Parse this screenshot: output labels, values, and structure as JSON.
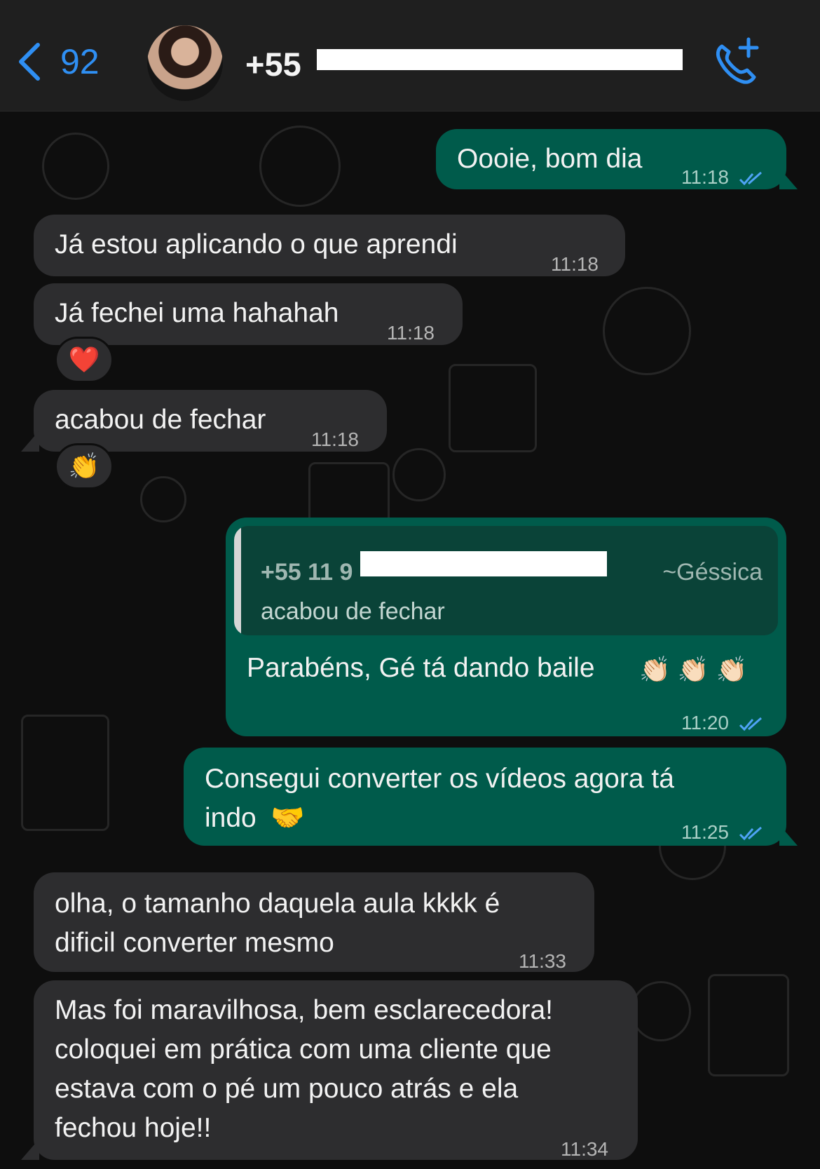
{
  "header": {
    "back_count": "92",
    "contact_phone_visible": "+55",
    "avatar_icon": "contact-avatar",
    "call_icon": "add-call-icon"
  },
  "colors": {
    "accent": "#2f8ff3",
    "outgoing_bubble": "#005b4b",
    "incoming_bubble": "#2d2d2f",
    "background": "#0e0e0e"
  },
  "messages": [
    {
      "direction": "out",
      "text": "Oooie, bom dia",
      "time": "11:18",
      "status": "read"
    },
    {
      "direction": "in",
      "text": "Já estou aplicando o que aprendi",
      "time": "11:18"
    },
    {
      "direction": "in",
      "text": "Já fechei uma hahahah",
      "time": "11:18",
      "reaction": "❤️"
    },
    {
      "direction": "in",
      "text": "acabou de fechar",
      "time": "11:18",
      "reaction": "👏"
    },
    {
      "direction": "out",
      "quote": {
        "phone": "+55 11 9",
        "name": "~Géssica",
        "text": "acabou de fechar"
      },
      "text": "Parabéns, Gé tá dando baile",
      "emoji": "👏🏻 👏🏻 👏🏻",
      "time": "11:20",
      "status": "read"
    },
    {
      "direction": "out",
      "line1": "Consegui converter os vídeos agora tá",
      "line2": "indo",
      "emoji": "🤝",
      "time": "11:25",
      "status": "read"
    },
    {
      "direction": "in",
      "line1": "olha, o tamanho daquela aula kkkk é",
      "line2": "dificil converter mesmo",
      "time": "11:33"
    },
    {
      "direction": "in",
      "line1": "Mas foi maravilhosa, bem esclarecedora!",
      "line2": "coloquei em prática com uma cliente que",
      "line3": "estava com o pé um pouco atrás e ela",
      "line4": "fechou hoje!!",
      "time": "11:34"
    }
  ]
}
